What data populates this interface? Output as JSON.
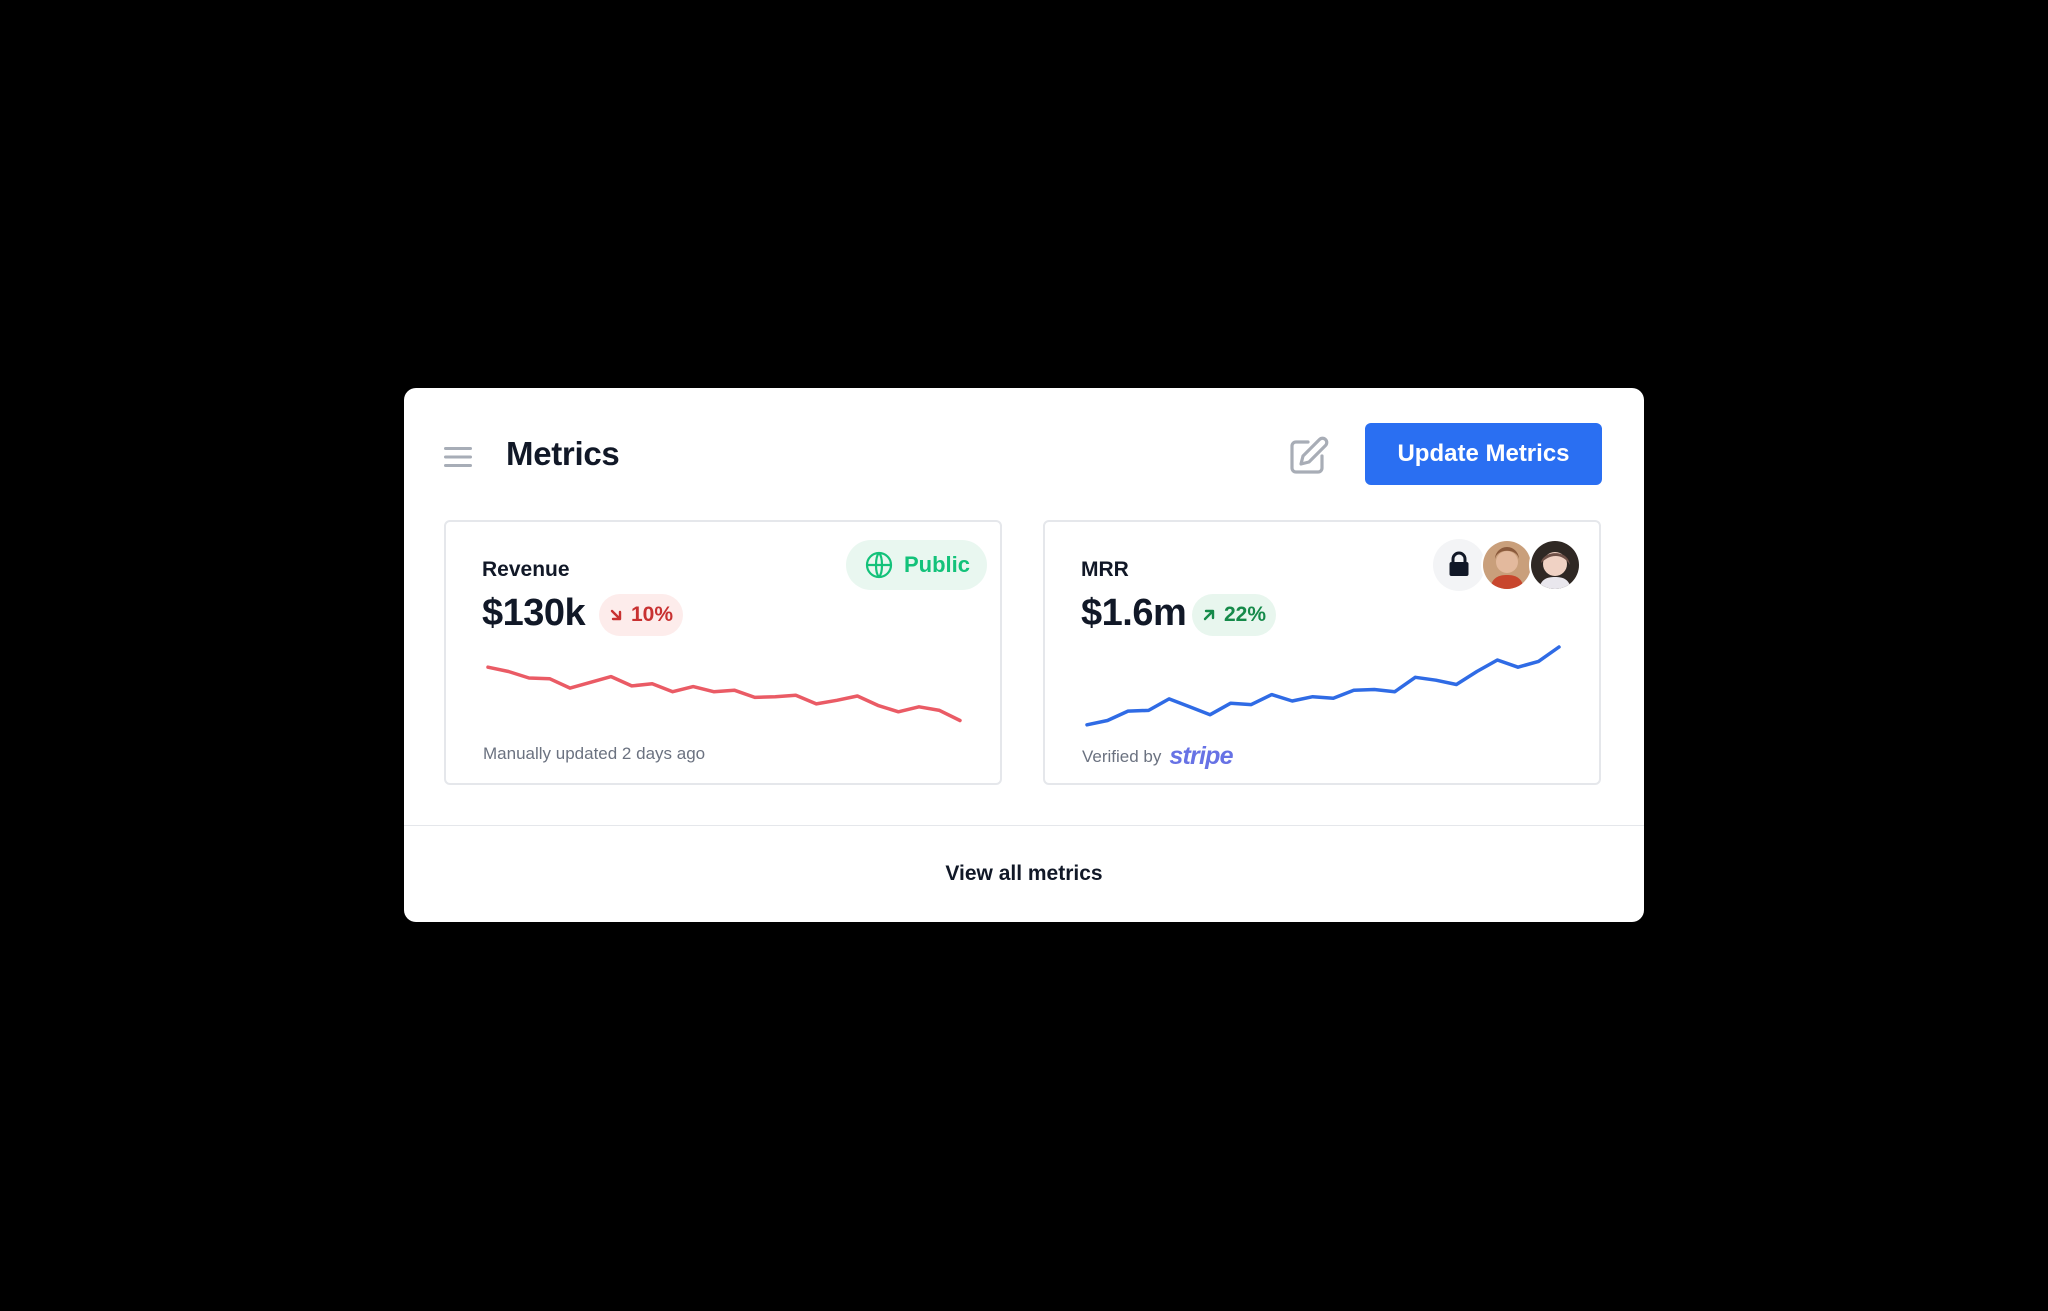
{
  "header": {
    "title": "Metrics",
    "update_button": "Update Metrics",
    "menu_icon": "hamburger-menu-icon",
    "edit_icon": "edit-icon"
  },
  "cards": [
    {
      "label": "Revenue",
      "value": "$130k",
      "delta": "10%",
      "delta_direction": "down",
      "badge": "Public",
      "badge_icon": "globe-icon",
      "footnote": "Manually updated 2 days ago",
      "color": "#ea5b65",
      "trend": [
        0.9,
        0.84,
        0.75,
        0.74,
        0.61,
        0.69,
        0.77,
        0.64,
        0.67,
        0.56,
        0.63,
        0.56,
        0.58,
        0.48,
        0.49,
        0.51,
        0.39,
        0.44,
        0.5,
        0.37,
        0.28,
        0.35,
        0.3,
        0.16
      ]
    },
    {
      "label": "MRR",
      "value": "$1.6m",
      "delta": "22%",
      "delta_direction": "up",
      "footnote_prefix": "Verified by",
      "footnote_brand": "stripe",
      "lock_icon": "lock-icon",
      "color": "#2f6be5",
      "trend": [
        0.1,
        0.16,
        0.29,
        0.3,
        0.46,
        0.35,
        0.24,
        0.4,
        0.38,
        0.52,
        0.43,
        0.49,
        0.47,
        0.58,
        0.59,
        0.56,
        0.76,
        0.72,
        0.66,
        0.84,
        1.0,
        0.9,
        0.98,
        1.18
      ]
    }
  ],
  "footer": {
    "link": "View all metrics"
  }
}
